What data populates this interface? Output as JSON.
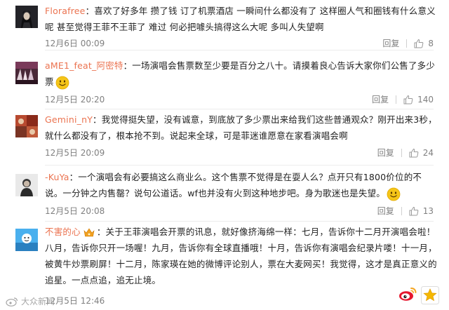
{
  "colors": {
    "username": "#eb7350",
    "text": "#222222",
    "meta": "#808080",
    "emoji": "#f5c518"
  },
  "actions": {
    "reply_label": "回复"
  },
  "comments": [
    {
      "username": "Florafree",
      "separator": "：",
      "text": "喜欢了好多年 攒了钱 订了机票酒店 一瞬间什么都没有了 这样圈人气和圈钱有什么意义呢 甚至觉得王菲不王菲了 难过 何必把噱头搞得这么大呢 多叫人失望啊",
      "time": "12月6日 00:09",
      "likes": "8"
    },
    {
      "username": "aME1_feat_阿密特",
      "separator": "：",
      "text": "一场演唱会售票数至少要是百分之八十。请摸着良心告诉大家你们公售了多少票",
      "time": "12月5日 20:20",
      "likes": "140"
    },
    {
      "username": "Gemini_nY",
      "separator": "：",
      "text": "我觉得挺失望，没有诚意，到底放了多少票出来给我们这些普通观众？刚开出来3秒，就什么都没有了，根本抢不到。说起来全球，可是菲迷谁愿意在家看演唱会啊",
      "time": "12月5日 20:09",
      "likes": "24"
    },
    {
      "username": "-KuYa",
      "separator": "：",
      "text": "一个演唱会有必要搞这么商业么。这个售票不觉得是在耍人么？点开只有1800价位的不说。一分钟之内售罄？说句公道话。wf也并没有火到这种地步吧。身为歌迷也是失望。",
      "time": "12月5日 20:08",
      "likes": "13"
    },
    {
      "username": "不害的心",
      "separator": "：",
      "text": "关于王菲演唱会开票的讯息，就好像挤海绵一样：七月，告诉你十二月开演唱会啦！八月，告诉你只开一场喔！九月，告诉你有全球直播哦！十月，告诉你有演唱会纪录片喽！十一月，被黄牛炒票刷屏！十二月，陈家瑛在她的微博评论别人，票在大麦网买！我觉得，这才是真正意义的追星。一点点追，追无止境。",
      "time": "12月5日 12:46"
    }
  ],
  "watermark": {
    "text": "大众新闻"
  }
}
